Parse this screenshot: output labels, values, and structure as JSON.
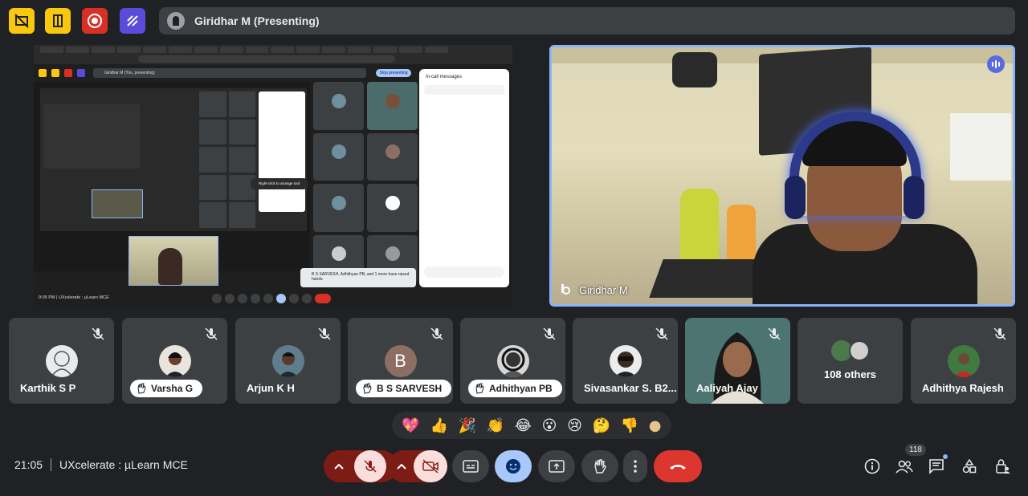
{
  "top_bar": {
    "presenter_label": "Giridhar M (Presenting)",
    "colors": {
      "yellow": "#f9c80e",
      "red": "#d93025",
      "purple": "#5b4bdb"
    }
  },
  "shared_screen": {
    "mini_title": "Giridhar M (You, presenting)",
    "stop_label": "Stop presenting",
    "chat_title": "In-call messages",
    "tooltip": "Right-click to arrange tool",
    "raised_hands_note": "B S SARVESH, Adhithyan PB, and 1 more have raised hands",
    "open_queue": "Open queue",
    "footer": "9:05 PM  |  UXcelerate : µLearn MCE"
  },
  "main_video": {
    "name": "Giridhar M"
  },
  "participants": [
    {
      "name": "Karthik S P",
      "muted": true,
      "hand": false
    },
    {
      "name": "Varsha G",
      "muted": true,
      "hand": true
    },
    {
      "name": "Arjun K H",
      "muted": true,
      "hand": false
    },
    {
      "name": "B S SARVESH",
      "muted": true,
      "hand": true,
      "initial": "B"
    },
    {
      "name": "Adhithyan PB",
      "muted": true,
      "hand": true
    },
    {
      "name": "Sivasankar S. B2...",
      "muted": true,
      "hand": false
    },
    {
      "name": "Aaliyah Ajay",
      "muted": true,
      "hand": false
    },
    {
      "name": "108 others",
      "muted": false,
      "hand": false
    },
    {
      "name": "Adhithya Rajesh",
      "muted": true,
      "hand": false
    }
  ],
  "reactions": [
    "💖",
    "👍",
    "🎉",
    "👏",
    "😂",
    "😮",
    "😢",
    "🤔",
    "👎",
    "●"
  ],
  "footer": {
    "time": "21:05",
    "meeting_name": "UXcelerate : µLearn MCE",
    "people_count": "118"
  }
}
